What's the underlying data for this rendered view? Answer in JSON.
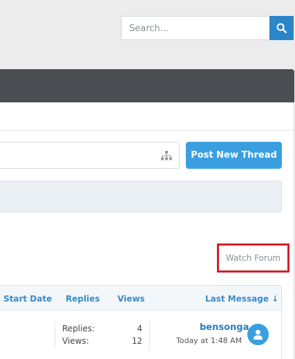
{
  "search": {
    "placeholder": "Search..."
  },
  "toolbar": {
    "post_new_thread": "Post New Thread"
  },
  "actions": {
    "watch_forum": "Watch Forum"
  },
  "thread_list": {
    "columns": {
      "start_date": "Start Date",
      "replies": "Replies",
      "views": "Views",
      "last_message": "Last Message ↓"
    },
    "rows": [
      {
        "replies_label": "Replies:",
        "replies": "4",
        "views_label": "Views:",
        "views": "12",
        "last_user": "bensonga",
        "last_time": "Today at 1:48 AM"
      }
    ]
  },
  "colors": {
    "accent": "#3a9fe0",
    "navbar": "#4a4e52",
    "highlight_border": "#d0202c"
  }
}
